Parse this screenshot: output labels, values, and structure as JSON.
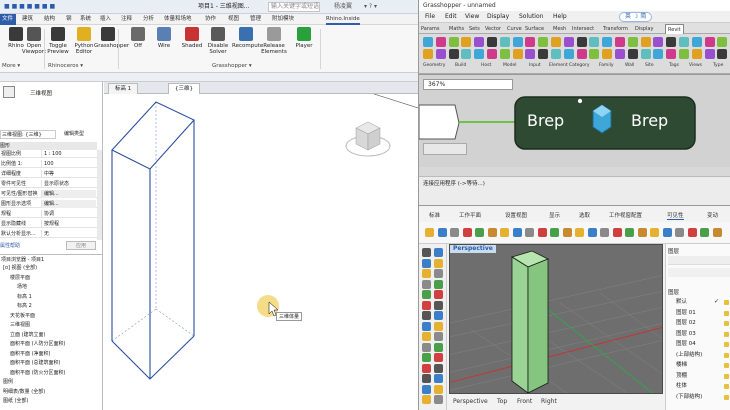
{
  "revit": {
    "title_left": "■ ■ ■ ■ ■ ■ ■",
    "title_text": "项目1 - 三维视图...",
    "title_right": "输入关键字或短语",
    "user": "杨凌翼",
    "menus": [
      "文件",
      "建筑",
      "结构",
      "钢",
      "系统",
      "插入",
      "注释",
      "分析",
      "体量和场地",
      "协作",
      "视图",
      "管理",
      "附加模块",
      "Rhino.Inside"
    ],
    "ribbon_buttons": [
      {
        "label": "Rhino",
        "color": "#3a3a3a"
      },
      {
        "label": "Open Viewport",
        "color": "#555555"
      },
      {
        "label": "Toggle Preview",
        "color": "#3a3a3a"
      },
      {
        "label": "Python Editor",
        "color": "#e0b020"
      },
      {
        "label": "Grasshopper",
        "color": "#3a3a3a"
      },
      {
        "label": "Off",
        "color": "#6a6a6a"
      },
      {
        "label": "Wire",
        "color": "#5a7fb5"
      },
      {
        "label": "Shaded",
        "color": "#c83232"
      },
      {
        "label": "Disable Solver",
        "color": "#5a5a5a"
      },
      {
        "label": "Recompute",
        "color": "#3a6fb0"
      },
      {
        "label": "Release Elements",
        "color": "#9a9a9a"
      },
      {
        "label": "Player",
        "color": "#28a03c"
      }
    ],
    "panels": [
      "More ▾",
      "Rhinoceros ▾",
      "Grasshopper ▾"
    ],
    "doc_tabs": [
      "标高 1",
      "{三维}"
    ],
    "props": {
      "type_name": "三维视图",
      "selector": "三维视图: {三维}",
      "edit_type": "编辑类型",
      "section": "图形",
      "rows": [
        {
          "k": "视图比例",
          "v": "1 : 100"
        },
        {
          "k": "比例值 1:",
          "v": "100"
        },
        {
          "k": "详细程度",
          "v": "中等"
        },
        {
          "k": "零件可见性",
          "v": "显示原状态"
        },
        {
          "k": "可见性/图形替换",
          "v": "编辑..."
        },
        {
          "k": "图形显示选项",
          "v": "编辑..."
        },
        {
          "k": "规程",
          "v": "协调"
        },
        {
          "k": "显示隐藏线",
          "v": "按规程"
        },
        {
          "k": "默认分析显示...",
          "v": "无"
        }
      ],
      "help_link": "属性帮助",
      "apply": "应用"
    },
    "browser": {
      "title": "项目浏览器 - 项目1",
      "items": [
        {
          "t": "[o] 视图 (全部)",
          "i": 0
        },
        {
          "t": "楼层平面",
          "i": 1
        },
        {
          "t": "场地",
          "i": 2
        },
        {
          "t": "标高 1",
          "i": 2
        },
        {
          "t": "标高 2",
          "i": 2
        },
        {
          "t": "天花板平面",
          "i": 1
        },
        {
          "t": "三维视图",
          "i": 1
        },
        {
          "t": "立面 (建筑立面)",
          "i": 1
        },
        {
          "t": "面积平面 (人防分区面积)",
          "i": 1
        },
        {
          "t": "面积平面 (净面积)",
          "i": 1
        },
        {
          "t": "面积平面 (总建筑面积)",
          "i": 1
        },
        {
          "t": "面积平面 (防火分区面积)",
          "i": 1
        },
        {
          "t": "图例",
          "i": 0
        },
        {
          "t": "明细表/数量 (全部)",
          "i": 0
        },
        {
          "t": "图纸 (全部)",
          "i": 0
        }
      ]
    },
    "tooltip": "三维体量"
  },
  "gh": {
    "title": "Grasshopper - unnamed",
    "menus": [
      "File",
      "Edit",
      "View",
      "Display",
      "Solution",
      "Help"
    ],
    "badge": "英 ☽ 简",
    "tabs": [
      "Params",
      "Maths",
      "Sets",
      "Vector",
      "Curve",
      "Surface",
      "Mesh",
      "Intersect",
      "Transform",
      "Display",
      "Revit"
    ],
    "section_labels": [
      "Geometry",
      "Build",
      "Host",
      "Model",
      "Input",
      "Element",
      "Category",
      "Family",
      "Wall",
      "Site",
      "Tags",
      "Views",
      "Type"
    ],
    "zoom": "367%",
    "node_in": "Brep",
    "node_out": "Brep",
    "status": "连接应用程序 (->等待...)"
  },
  "rhino": {
    "tabs": [
      "标准",
      "工作平面",
      "设置视图",
      "显示",
      "选取",
      "工作视窗配置",
      "可见性",
      "变动"
    ],
    "viewport_label": "Perspective",
    "view_tabs": [
      "Perspective",
      "Top",
      "Front",
      "Right"
    ],
    "layers": {
      "header": "图层",
      "title": "图层",
      "items": [
        "默认",
        "图层 01",
        "图层 02",
        "图层 03",
        "图层 04",
        "(上部结构)",
        "楼梯",
        "顶棚",
        "柱体",
        "(下部结构)"
      ]
    }
  },
  "colors": {
    "gh_node": "#2f4a33",
    "gh_wire": "#6ec24a",
    "revit_line": "#2a4fa0",
    "box_fill": "#9ad494",
    "viewport_bg": "#6e6e6e"
  }
}
